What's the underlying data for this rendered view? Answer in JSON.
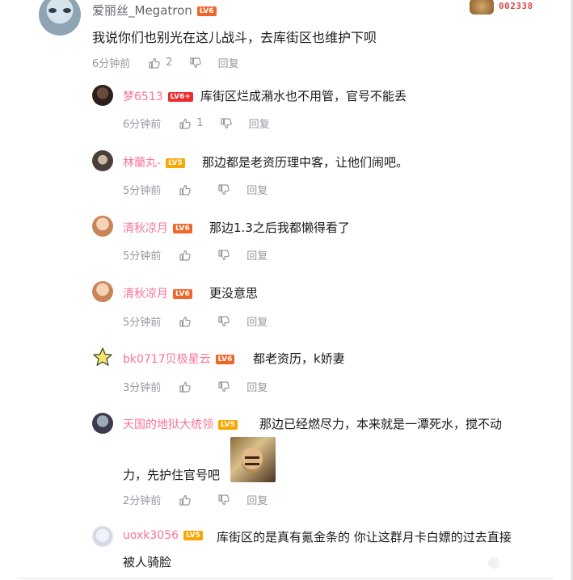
{
  "main_comment": {
    "username": "爱丽丝_Megatron",
    "level": "LV6",
    "fan_badge_number": "002338",
    "content": "我说你们也别光在这儿战斗，去库街区也维护下呗",
    "time": "6分钟前",
    "likes": "2",
    "reply_label": "回复"
  },
  "replies": [
    {
      "username": "梦6513",
      "level": "LV6+",
      "content": "库街区烂成潲水也不用管，官号不能丢",
      "time": "6分钟前",
      "likes": "1",
      "reply_label": "回复"
    },
    {
      "username": "林蘭丸-",
      "level": "LV5",
      "content": "那边都是老资历理中客，让他们闹吧。",
      "time": "5分钟前",
      "likes": "",
      "reply_label": "回复"
    },
    {
      "username": "清秋凉月",
      "level": "LV6",
      "content": "那边1.3之后我都懒得看了",
      "time": "5分钟前",
      "likes": "",
      "reply_label": "回复"
    },
    {
      "username": "清秋凉月",
      "level": "LV6",
      "content": "更没意思",
      "time": "5分钟前",
      "likes": "",
      "reply_label": "回复"
    },
    {
      "username": "bk0717贝极星云",
      "level": "LV6",
      "content": "都老资历，k娇妻",
      "time": "3分钟前",
      "likes": "",
      "reply_label": "回复"
    },
    {
      "username": "天国的地狱大统领",
      "level": "LV5",
      "content_line1": "那边已经燃尽力，本来就是一潭死水，搅不动",
      "content_line2": "力，先护住官号吧",
      "time": "2分钟前",
      "likes": "",
      "reply_label": "回复"
    },
    {
      "username": "uoxk3056",
      "level": "LV5",
      "content_line1": "库街区的是真有氪金条的 你让这群月卡白嫖的过去直接",
      "content_line2": "被人骑脸"
    }
  ],
  "icons": {
    "like": "thumbs-up-icon",
    "dislike": "thumbs-down-icon"
  }
}
